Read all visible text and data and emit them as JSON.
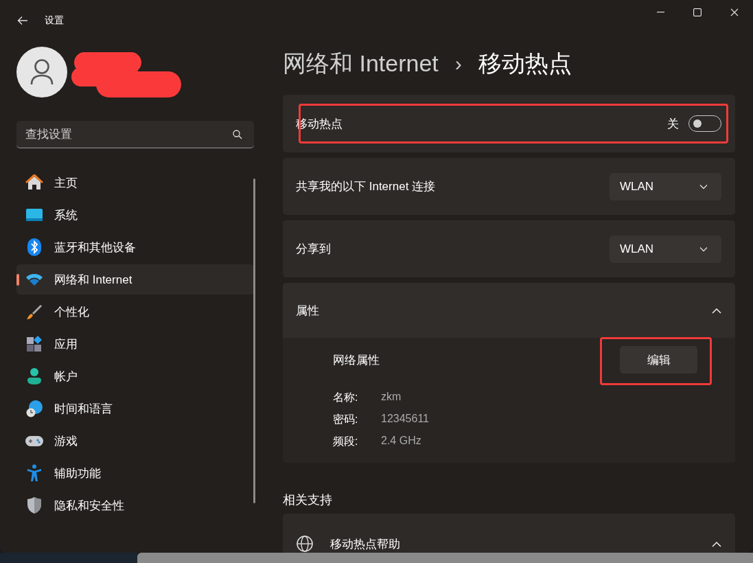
{
  "window": {
    "title": "设置"
  },
  "search": {
    "placeholder": "查找设置"
  },
  "sidebar": {
    "items": [
      {
        "label": "主页",
        "kind": "home",
        "selected": false
      },
      {
        "label": "系统",
        "kind": "system",
        "selected": false
      },
      {
        "label": "蓝牙和其他设备",
        "kind": "bluetooth",
        "selected": false
      },
      {
        "label": "网络和 Internet",
        "kind": "network",
        "selected": true
      },
      {
        "label": "个性化",
        "kind": "personalize",
        "selected": false
      },
      {
        "label": "应用",
        "kind": "apps",
        "selected": false
      },
      {
        "label": "帐户",
        "kind": "account",
        "selected": false
      },
      {
        "label": "时间和语言",
        "kind": "time",
        "selected": false
      },
      {
        "label": "游戏",
        "kind": "gaming",
        "selected": false
      },
      {
        "label": "辅助功能",
        "kind": "accessibility",
        "selected": false
      },
      {
        "label": "隐私和安全性",
        "kind": "privacy",
        "selected": false
      }
    ]
  },
  "breadcrumb": {
    "parent": "网络和 Internet",
    "separator": "›",
    "current": "移动热点"
  },
  "cards": [
    {
      "kind": "toggle",
      "label": "移动热点",
      "state_label": "关",
      "on": false
    },
    {
      "kind": "dropdown",
      "label": "共享我的以下 Internet 连接",
      "value": "WLAN"
    },
    {
      "kind": "dropdown",
      "label": "分享到",
      "value": "WLAN"
    },
    {
      "kind": "expander",
      "label": "属性",
      "expanded": true,
      "subtitle": "网络属性",
      "button": "编辑",
      "properties": [
        {
          "name": "名称:",
          "value": "zkm"
        },
        {
          "name": "密码:",
          "value": "12345611"
        },
        {
          "name": "频段:",
          "value": "2.4 GHz"
        }
      ]
    }
  ],
  "related": {
    "title": "相关支持",
    "items": [
      {
        "label": "移动热点帮助",
        "expanded": true
      }
    ]
  }
}
